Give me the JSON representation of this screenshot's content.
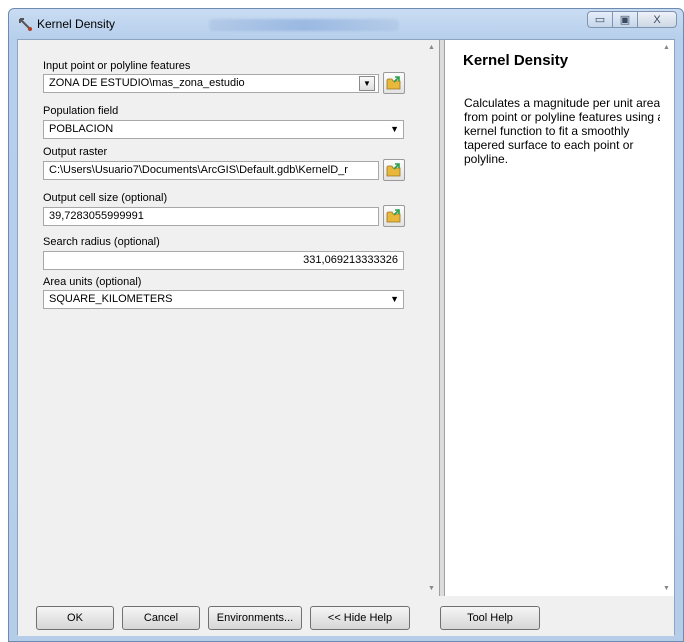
{
  "window": {
    "title": "Kernel Density",
    "controls": {
      "minimize": "▭",
      "maximize": "▣",
      "close": "X"
    }
  },
  "params": {
    "input": {
      "label": "Input point or polyline features",
      "value": "ZONA DE ESTUDIO\\mas_zona_estudio"
    },
    "population": {
      "label": "Population field",
      "value": "POBLACION"
    },
    "output_raster": {
      "label": "Output raster",
      "value": "C:\\Users\\Usuario7\\Documents\\ArcGIS\\Default.gdb\\KernelD_r"
    },
    "cell_size": {
      "label": "Output cell size (optional)",
      "value": "39,7283055999991"
    },
    "search_radius": {
      "label": "Search radius (optional)",
      "value": "331,069213333326"
    },
    "area_units": {
      "label": "Area units (optional)",
      "value": "SQUARE_KILOMETERS"
    }
  },
  "help": {
    "title": "Kernel Density",
    "body": "Calculates a magnitude per unit area from point or polyline features using a kernel function to fit a smoothly tapered surface to each point or polyline."
  },
  "buttons": {
    "ok": "OK",
    "cancel": "Cancel",
    "environments": "Environments...",
    "hide_help": "<< Hide Help",
    "tool_help": "Tool Help"
  },
  "icons": {
    "app": "kernel-density-tool-icon",
    "browse": "folder-browse-icon"
  },
  "colors": {
    "titlebar": "#b7cfec",
    "panel": "#f0f0f0",
    "folder": "#e8b83a",
    "folder_arrow": "#2aa04a"
  }
}
